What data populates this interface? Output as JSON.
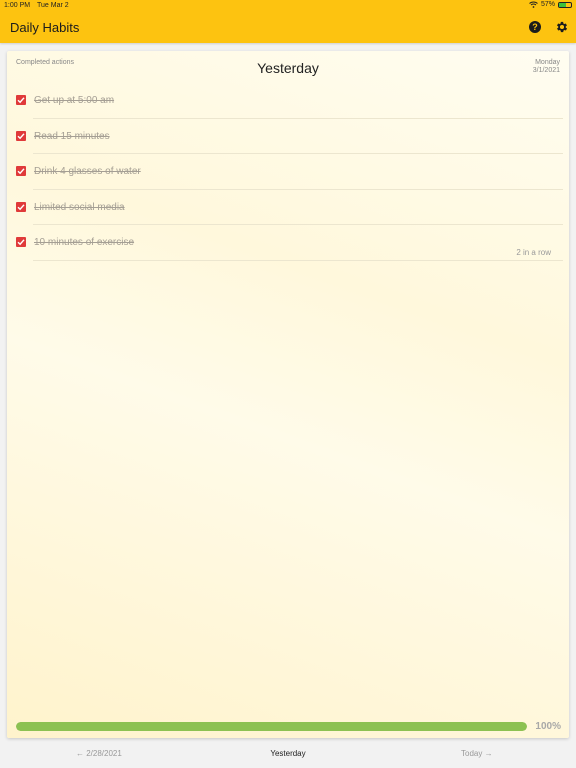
{
  "status_bar": {
    "time": "1:00 PM",
    "date": "Tue Mar 2",
    "battery_text": "57%",
    "battery_level": 0.57
  },
  "app_bar": {
    "title": "Daily Habits",
    "help_icon": "question-circle-icon",
    "settings_icon": "gear-icon"
  },
  "card": {
    "left_label": "Completed actions",
    "title": "Yesterday",
    "day_name": "Monday",
    "date": "3/1/2021",
    "habits": [
      {
        "label": "Get up at 5:00 am",
        "checked": true
      },
      {
        "label": "Read 15 minutes",
        "checked": true
      },
      {
        "label": "Drink 4 glasses of water",
        "checked": true
      },
      {
        "label": "Limited social media",
        "checked": true
      },
      {
        "label": "10 minutes of exercise",
        "checked": true
      }
    ],
    "streak_text": "2 in a row",
    "progress_percent": 100,
    "progress_label": "100%"
  },
  "bottom_nav": {
    "prev": "← 2/28/2021",
    "current": "Yesterday",
    "next": "Today →"
  },
  "colors": {
    "accent": "#fdc310",
    "checkbox": "#e03a3a",
    "progress": "#8cc152"
  }
}
